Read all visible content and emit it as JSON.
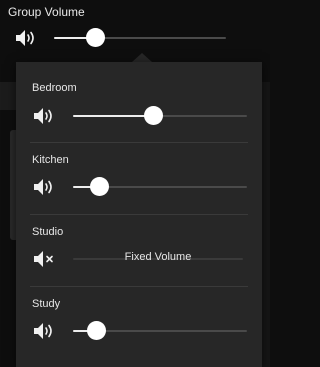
{
  "group": {
    "title": "Group Volume",
    "level": 0.24,
    "icon": "speaker-volume-icon"
  },
  "rooms": [
    {
      "label": "Bedroom",
      "level": 0.46,
      "icon": "speaker-volume-icon"
    },
    {
      "label": "Kitchen",
      "level": 0.15,
      "icon": "speaker-volume-icon"
    },
    {
      "label": "Studio",
      "status": "Fixed Volume",
      "icon": "speaker-muted-icon"
    },
    {
      "label": "Study",
      "level": 0.13,
      "icon": "speaker-volume-icon"
    }
  ],
  "colors": {
    "background": "#0e0e0e",
    "popover": "#272727",
    "track": "#4a4a4a",
    "fill": "#ededed",
    "thumb": "#ffffff"
  }
}
